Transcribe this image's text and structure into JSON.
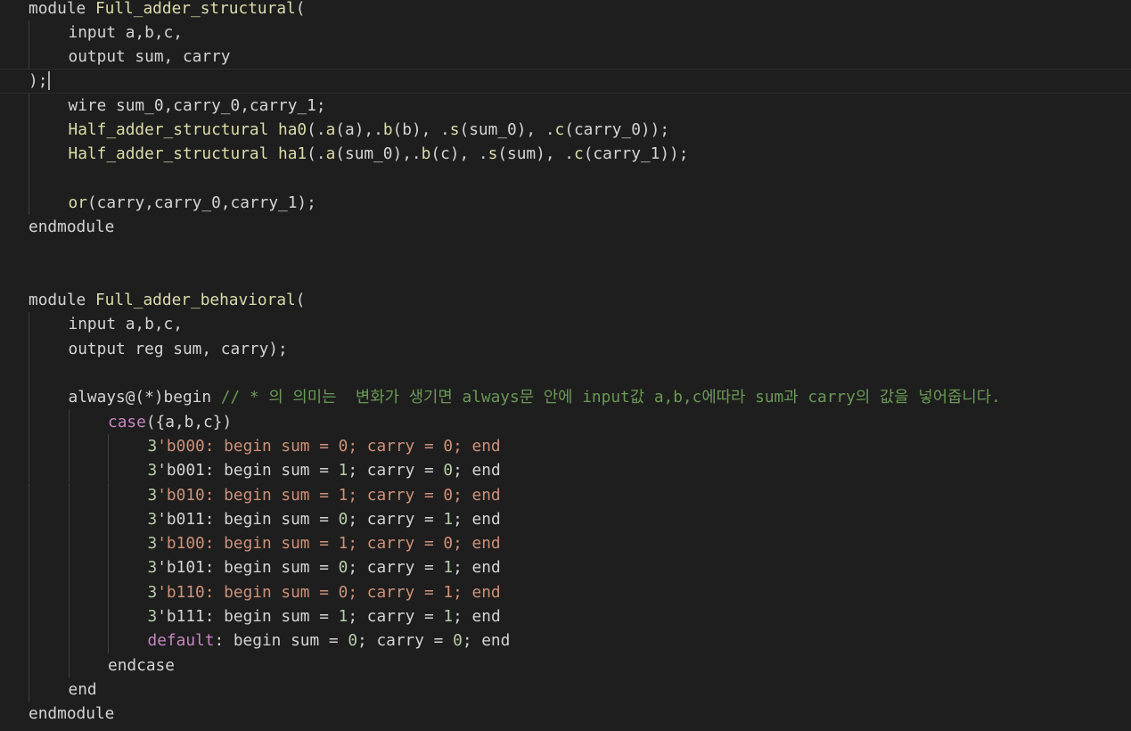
{
  "editor": {
    "theme_colors": {
      "background": "#1e1e1e",
      "default_text": "#d4d4d4",
      "function": "#dcdcaa",
      "control_keyword": "#c586c0",
      "number": "#b5cea8",
      "string_literal": "#ce9178",
      "comment": "#6a9955",
      "indent_guide": "#404040"
    },
    "lines": [
      {
        "indent": 0,
        "tokens": [
          [
            "kw",
            "module "
          ],
          [
            "fn",
            "Full_adder_structural"
          ],
          [
            "kw",
            "("
          ]
        ]
      },
      {
        "indent": 1,
        "tokens": [
          [
            "kw",
            "input a,b,c,"
          ]
        ]
      },
      {
        "indent": 1,
        "tokens": [
          [
            "kw",
            "output sum, carry"
          ]
        ]
      },
      {
        "indent": 0,
        "current": true,
        "tokens": [
          [
            "kw",
            ");"
          ]
        ]
      },
      {
        "indent": 1,
        "tokens": [
          [
            "kw",
            "wire sum_0,carry_0,carry_1;"
          ]
        ]
      },
      {
        "indent": 1,
        "tokens": [
          [
            "fn",
            "Half_adder_structural ha0"
          ],
          [
            "kw",
            "(."
          ],
          [
            "fn",
            "a"
          ],
          [
            "kw",
            "(a),."
          ],
          [
            "fn",
            "b"
          ],
          [
            "kw",
            "(b), ."
          ],
          [
            "fn",
            "s"
          ],
          [
            "kw",
            "(sum_0), ."
          ],
          [
            "fn",
            "c"
          ],
          [
            "kw",
            "(carry_0));"
          ]
        ]
      },
      {
        "indent": 1,
        "tokens": [
          [
            "fn",
            "Half_adder_structural ha1"
          ],
          [
            "kw",
            "(."
          ],
          [
            "fn",
            "a"
          ],
          [
            "kw",
            "(sum_0),."
          ],
          [
            "fn",
            "b"
          ],
          [
            "kw",
            "(c), ."
          ],
          [
            "fn",
            "s"
          ],
          [
            "kw",
            "(sum), ."
          ],
          [
            "fn",
            "c"
          ],
          [
            "kw",
            "(carry_1));"
          ]
        ]
      },
      {
        "indent": 1,
        "tokens": []
      },
      {
        "indent": 1,
        "tokens": [
          [
            "fn",
            "or"
          ],
          [
            "kw",
            "(carry,carry_0,carry_1);"
          ]
        ]
      },
      {
        "indent": 0,
        "tokens": [
          [
            "kw",
            "endmodule"
          ]
        ]
      },
      {
        "indent": 0,
        "tokens": []
      },
      {
        "indent": 0,
        "tokens": []
      },
      {
        "indent": 0,
        "tokens": [
          [
            "kw",
            "module "
          ],
          [
            "fn",
            "Full_adder_behavioral"
          ],
          [
            "kw",
            "("
          ]
        ]
      },
      {
        "indent": 1,
        "tokens": [
          [
            "kw",
            "input a,b,c,"
          ]
        ]
      },
      {
        "indent": 1,
        "tokens": [
          [
            "kw",
            "output reg sum, carry);"
          ]
        ]
      },
      {
        "indent": 1,
        "tokens": []
      },
      {
        "indent": 1,
        "tokens": [
          [
            "kw",
            "always@(*)begin "
          ],
          [
            "cm",
            "// * 의 의미는  변화가 생기면 always문 안에 input값 a,b,c에따라 sum과 carry의 값을 넣어줍니다."
          ]
        ]
      },
      {
        "indent": 2,
        "tokens": [
          [
            "def",
            "case"
          ],
          [
            "kw",
            "({a,b,c})"
          ]
        ]
      },
      {
        "indent": 3,
        "tokens": [
          [
            "num",
            "3"
          ],
          [
            "str",
            "'b000: begin sum = 0; carry = 0; end"
          ]
        ]
      },
      {
        "indent": 3,
        "tokens": [
          [
            "num",
            "3"
          ],
          [
            "kw",
            "'b001: begin sum = "
          ],
          [
            "num",
            "1"
          ],
          [
            "kw",
            "; carry = "
          ],
          [
            "num",
            "0"
          ],
          [
            "kw",
            "; end"
          ]
        ]
      },
      {
        "indent": 3,
        "tokens": [
          [
            "num",
            "3"
          ],
          [
            "str",
            "'b010: begin sum = 1; carry = 0; end"
          ]
        ]
      },
      {
        "indent": 3,
        "tokens": [
          [
            "num",
            "3"
          ],
          [
            "kw",
            "'b011: begin sum = "
          ],
          [
            "num",
            "0"
          ],
          [
            "kw",
            "; carry = "
          ],
          [
            "num",
            "1"
          ],
          [
            "kw",
            "; end"
          ]
        ]
      },
      {
        "indent": 3,
        "tokens": [
          [
            "num",
            "3"
          ],
          [
            "str",
            "'b100: begin sum = 1; carry = 0; end"
          ]
        ]
      },
      {
        "indent": 3,
        "tokens": [
          [
            "num",
            "3"
          ],
          [
            "kw",
            "'b101: begin sum = "
          ],
          [
            "num",
            "0"
          ],
          [
            "kw",
            "; carry = "
          ],
          [
            "num",
            "1"
          ],
          [
            "kw",
            "; end"
          ]
        ]
      },
      {
        "indent": 3,
        "tokens": [
          [
            "num",
            "3"
          ],
          [
            "str",
            "'b110: begin sum = 0; carry = 1; end"
          ]
        ]
      },
      {
        "indent": 3,
        "tokens": [
          [
            "num",
            "3"
          ],
          [
            "kw",
            "'b111: begin sum = "
          ],
          [
            "num",
            "1"
          ],
          [
            "kw",
            "; carry = "
          ],
          [
            "num",
            "1"
          ],
          [
            "kw",
            "; end"
          ]
        ]
      },
      {
        "indent": 3,
        "tokens": [
          [
            "def",
            "default"
          ],
          [
            "kw",
            ": begin sum = "
          ],
          [
            "num",
            "0"
          ],
          [
            "kw",
            "; carry = "
          ],
          [
            "num",
            "0"
          ],
          [
            "kw",
            "; end"
          ]
        ]
      },
      {
        "indent": 2,
        "tokens": [
          [
            "kw",
            "endcase"
          ]
        ]
      },
      {
        "indent": 1,
        "tokens": [
          [
            "kw",
            "end"
          ]
        ]
      },
      {
        "indent": 0,
        "tokens": [
          [
            "kw",
            "endmodule"
          ]
        ]
      }
    ]
  }
}
